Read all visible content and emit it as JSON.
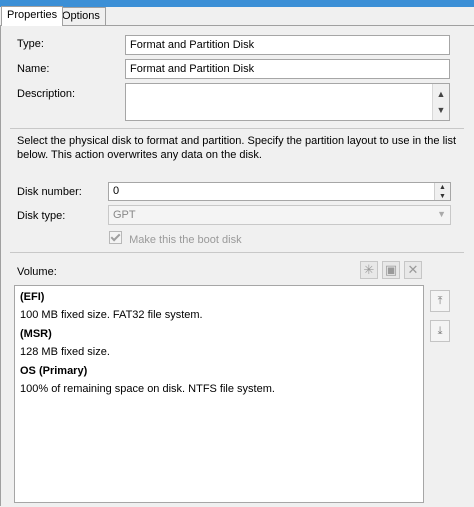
{
  "tabs": [
    {
      "label": "Properties",
      "active": true
    },
    {
      "label": "Options",
      "active": false
    }
  ],
  "fields": {
    "type_label": "Type:",
    "type_value": "Format and Partition Disk",
    "name_label": "Name:",
    "name_value": "Format and Partition Disk",
    "description_label": "Description:",
    "description_value": ""
  },
  "instructions": "Select the physical disk to format and partition. Specify the partition layout to use in the list below. This action overwrites any data on the disk.",
  "disk": {
    "number_label": "Disk number:",
    "number_value": "0",
    "type_label": "Disk type:",
    "type_value": "GPT",
    "boot_checkbox_label": "Make this the boot disk",
    "boot_checked": true
  },
  "volume": {
    "label": "Volume:",
    "items": [
      {
        "title": "(EFI)",
        "description": "100 MB fixed size. FAT32 file system."
      },
      {
        "title": "(MSR)",
        "description": "128 MB fixed size."
      },
      {
        "title": "OS (Primary)",
        "description": "100% of remaining space on disk. NTFS file system."
      }
    ]
  },
  "icons": {
    "new": "star-icon",
    "properties": "properties-icon",
    "delete": "delete-x-icon",
    "move_up": "move-up-icon",
    "move_down": "move-down-icon"
  },
  "colors": {
    "accent": "#3b8fd6",
    "background": "#f0f0f0"
  }
}
